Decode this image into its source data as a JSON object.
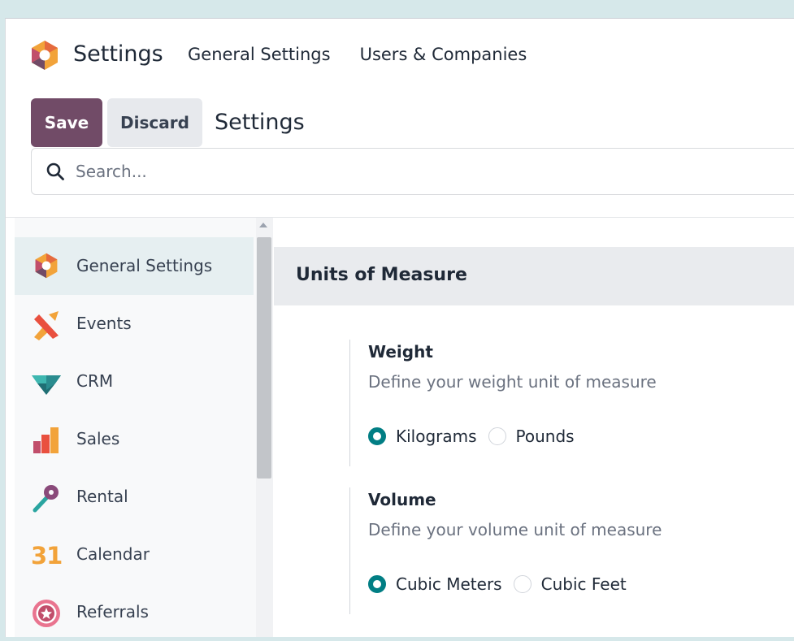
{
  "navbar": {
    "app_title": "Settings",
    "menu": [
      "General Settings",
      "Users & Companies"
    ]
  },
  "control_panel": {
    "save_label": "Save",
    "discard_label": "Discard",
    "breadcrumb": "Settings",
    "search_placeholder": "Search..."
  },
  "sidebar": {
    "items": [
      {
        "label": "General Settings",
        "icon": "general-settings-icon"
      },
      {
        "label": "Events",
        "icon": "events-icon"
      },
      {
        "label": "CRM",
        "icon": "crm-icon"
      },
      {
        "label": "Sales",
        "icon": "sales-icon"
      },
      {
        "label": "Rental",
        "icon": "rental-icon"
      },
      {
        "label": "Calendar",
        "icon": "calendar-icon"
      },
      {
        "label": "Referrals",
        "icon": "referrals-icon"
      }
    ],
    "calendar_glyph": "31"
  },
  "main": {
    "section_title": "Units of Measure",
    "weight": {
      "title": "Weight",
      "description": "Define your weight unit of measure",
      "options": [
        "Kilograms",
        "Pounds"
      ],
      "selected": "Kilograms"
    },
    "volume": {
      "title": "Volume",
      "description": "Define your volume unit of measure",
      "options": [
        "Cubic Meters",
        "Cubic Feet"
      ],
      "selected": "Cubic Meters"
    }
  },
  "colors": {
    "brand_primary": "#714b67",
    "accent_teal": "#017e84",
    "active_item_bg": "#e6eff1"
  }
}
